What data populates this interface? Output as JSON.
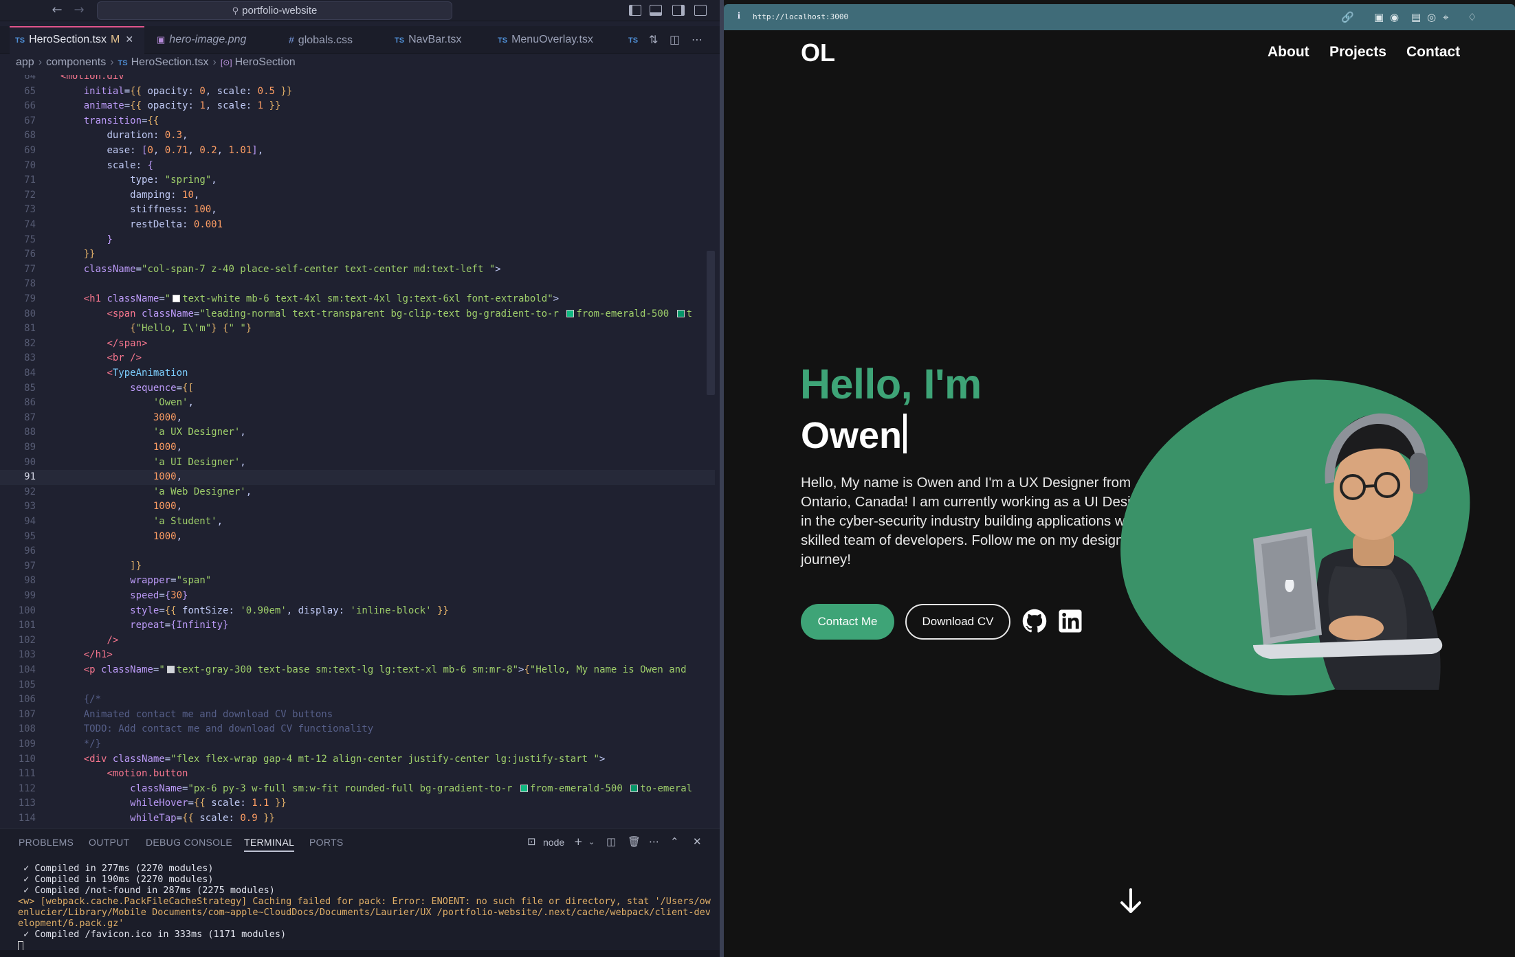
{
  "editor": {
    "search": "portfolio-website",
    "tabs": [
      {
        "label": "HeroSection.tsx",
        "kind": "ts",
        "modified": "M",
        "active": true
      },
      {
        "label": "hero-image.png",
        "kind": "img",
        "italic": true
      },
      {
        "label": "globals.css",
        "kind": "css"
      },
      {
        "label": "NavBar.tsx",
        "kind": "ts"
      },
      {
        "label": "MenuOverlay.tsx",
        "kind": "ts"
      }
    ],
    "ts_badge": "TS",
    "breadcrumb": [
      "app",
      "components",
      "HeroSection.tsx",
      "HeroSection"
    ],
    "current_line": 91,
    "code_lines": [
      {
        "n": 64,
        "h": "        <span class='tag'>&lt;motion.div</span>"
      },
      {
        "n": 65,
        "h": "            <span class='a'>initial</span><span class='p'>=</span><span class='b'>{{</span> <span class='p'>opacity:</span> <span class='n'>0</span><span class='p'>,</span> <span class='p'>scale:</span> <span class='n'>0.5</span> <span class='b'>}}</span>"
      },
      {
        "n": 66,
        "h": "            <span class='a'>animate</span><span class='p'>=</span><span class='b'>{{</span> <span class='p'>opacity:</span> <span class='n'>1</span><span class='p'>,</span> <span class='p'>scale:</span> <span class='n'>1</span> <span class='b'>}}</span>"
      },
      {
        "n": 67,
        "h": "            <span class='a'>transition</span><span class='p'>=</span><span class='b'>{{</span>"
      },
      {
        "n": 68,
        "h": "                <span class='p'>duration:</span> <span class='n'>0.3</span><span class='p'>,</span>"
      },
      {
        "n": 69,
        "h": "                <span class='p'>ease:</span> <span class='a'>[</span><span class='n'>0</span><span class='p'>,</span> <span class='n'>0.71</span><span class='p'>,</span> <span class='n'>0.2</span><span class='p'>,</span> <span class='n'>1.01</span><span class='a'>]</span><span class='p'>,</span>"
      },
      {
        "n": 70,
        "h": "                <span class='p'>scale:</span> <span class='a'>{</span>"
      },
      {
        "n": 71,
        "h": "                    <span class='p'>type:</span> <span class='s'>\"spring\"</span><span class='p'>,</span>"
      },
      {
        "n": 72,
        "h": "                    <span class='p'>damping:</span> <span class='n'>10</span><span class='p'>,</span>"
      },
      {
        "n": 73,
        "h": "                    <span class='p'>stiffness:</span> <span class='n'>100</span><span class='p'>,</span>"
      },
      {
        "n": 74,
        "h": "                    <span class='p'>restDelta:</span> <span class='n'>0.001</span>"
      },
      {
        "n": 75,
        "h": "                <span class='a'>}</span>"
      },
      {
        "n": 76,
        "h": "            <span class='b'>}}</span>"
      },
      {
        "n": 77,
        "h": "            <span class='a'>className</span><span class='p'>=</span><span class='s'>\"col-span-7 z-40 place-self-center text-center md:text-left \"</span><span class='p'>&gt;</span>"
      },
      {
        "n": 78,
        "h": ""
      },
      {
        "n": 79,
        "h": "            <span class='tag'>&lt;h1</span> <span class='a'>className</span><span class='p'>=</span><span class='s'>\"<span class='sw' style='background:#fff'></span>text-white mb-6 text-4xl sm:text-4xl lg:text-6xl font-extrabold\"</span><span class='p'>&gt;</span>"
      },
      {
        "n": 80,
        "h": "                <span class='tag'>&lt;span</span> <span class='a'>className</span><span class='p'>=</span><span class='s'>\"leading-normal text-transparent bg-clip-text bg-gradient-to-r <span class='sw' style='background:#10b981'></span>from-emerald-500 <span class='sw' style='background:#059669'></span>t</span>"
      },
      {
        "n": 81,
        "h": "                    <span class='b'>{</span><span class='s'>\"Hello, I\\'m\"</span><span class='b'>}</span> <span class='b'>{</span><span class='s'>\" \"</span><span class='b'>}</span>"
      },
      {
        "n": 82,
        "h": "                <span class='tag'>&lt;/span&gt;</span>"
      },
      {
        "n": 83,
        "h": "                <span class='tag'>&lt;br</span> <span class='tag'>/&gt;</span>"
      },
      {
        "n": 84,
        "h": "                <span class='tag'>&lt;</span><span class='t'>TypeAnimation</span>"
      },
      {
        "n": 85,
        "h": "                    <span class='a'>sequence</span><span class='p'>=</span><span class='b'>{[</span>"
      },
      {
        "n": 86,
        "h": "                        <span class='s'>'Owen'</span><span class='p'>,</span>"
      },
      {
        "n": 87,
        "h": "                        <span class='n'>3000</span><span class='p'>,</span>"
      },
      {
        "n": 88,
        "h": "                        <span class='s'>'a UX Designer'</span><span class='p'>,</span>"
      },
      {
        "n": 89,
        "h": "                        <span class='n'>1000</span><span class='p'>,</span>"
      },
      {
        "n": 90,
        "h": "                        <span class='s'>'a UI Designer'</span><span class='p'>,</span>"
      },
      {
        "n": 91,
        "h": "                        <span class='n'>1000</span><span class='p'>,</span>"
      },
      {
        "n": 92,
        "h": "                        <span class='s'>'a Web Designer'</span><span class='p'>,</span>"
      },
      {
        "n": 93,
        "h": "                        <span class='n'>1000</span><span class='p'>,</span>"
      },
      {
        "n": 94,
        "h": "                        <span class='s'>'a Student'</span><span class='p'>,</span>"
      },
      {
        "n": 95,
        "h": "                        <span class='n'>1000</span><span class='p'>,</span>"
      },
      {
        "n": 96,
        "h": ""
      },
      {
        "n": 97,
        "h": "                    <span class='b'>]}</span>"
      },
      {
        "n": 98,
        "h": "                    <span class='a'>wrapper</span><span class='p'>=</span><span class='s'>\"span\"</span>"
      },
      {
        "n": 99,
        "h": "                    <span class='a'>speed</span><span class='p'>=</span><span class='a'>{</span><span class='n'>30</span><span class='a'>}</span>"
      },
      {
        "n": 100,
        "h": "                    <span class='a'>style</span><span class='p'>=</span><span class='b'>{{</span> <span class='p'>fontSize:</span> <span class='s'>'0.90em'</span><span class='p'>,</span> <span class='p'>display:</span> <span class='s'>'inline-block'</span> <span class='b'>}}</span>"
      },
      {
        "n": 101,
        "h": "                    <span class='a'>repeat</span><span class='p'>=</span><span class='a'>{Infinity}</span>"
      },
      {
        "n": 102,
        "h": "                <span class='tag'>/&gt;</span>"
      },
      {
        "n": 103,
        "h": "            <span class='tag'>&lt;/h1&gt;</span>"
      },
      {
        "n": 104,
        "h": "            <span class='tag'>&lt;p</span> <span class='a'>className</span><span class='p'>=</span><span class='s'>\"<span class='sw' style='background:#d1d5db'></span>text-gray-300 text-base sm:text-lg lg:text-xl mb-6 sm:mr-8\"</span><span class='p'>&gt;</span><span class='b'>{</span><span class='s'>\"Hello, My name is Owen and</span>"
      },
      {
        "n": 105,
        "h": ""
      },
      {
        "n": 106,
        "h": "            <span class='c'>{/*</span>"
      },
      {
        "n": 107,
        "h": "            <span class='c'>Animated contact me and download CV buttons</span>"
      },
      {
        "n": 108,
        "h": "            <span class='c'>TODO: Add contact me and download CV functionality</span>"
      },
      {
        "n": 109,
        "h": "            <span class='c'>*/}</span>"
      },
      {
        "n": 110,
        "h": "            <span class='tag'>&lt;div</span> <span class='a'>className</span><span class='p'>=</span><span class='s'>\"flex flex-wrap gap-4 mt-12 align-center justify-center lg:justify-start \"</span><span class='p'>&gt;</span>"
      },
      {
        "n": 111,
        "h": "                <span class='tag'>&lt;motion.button</span>"
      },
      {
        "n": 112,
        "h": "                    <span class='a'>className</span><span class='p'>=</span><span class='s'>\"px-6 py-3 w-full sm:w-fit rounded-full bg-gradient-to-r <span class='sw' style='background:#10b981'></span>from-emerald-500 <span class='sw' style='background:#059669'></span>to-emeral</span>"
      },
      {
        "n": 113,
        "h": "                    <span class='a'>whileHover</span><span class='p'>=</span><span class='b'>{{</span> <span class='p'>scale:</span> <span class='n'>1.1</span> <span class='b'>}}</span>"
      },
      {
        "n": 114,
        "h": "                    <span class='a'>whileTap</span><span class='p'>=</span><span class='b'>{{</span> <span class='p'>scale:</span> <span class='n'>0.9</span> <span class='b'>}}</span>"
      }
    ],
    "panel": {
      "tabs": [
        "PROBLEMS",
        "OUTPUT",
        "DEBUG CONSOLE",
        "TERMINAL",
        "PORTS"
      ],
      "active_tab": "TERMINAL",
      "shell": "node",
      "terminal": [
        {
          "kind": "ok",
          "text": " ✓ Compiled in 277ms (2270 modules)"
        },
        {
          "kind": "ok",
          "text": " ✓ Compiled in 190ms (2270 modules)"
        },
        {
          "kind": "ok",
          "text": " ✓ Compiled /not-found in 287ms (2275 modules)"
        },
        {
          "kind": "warn",
          "text": "<w> [webpack.cache.PackFileCacheStrategy] Caching failed for pack: Error: ENOENT: no such file or directory, stat '/Users/owenlucier/Library/Mobile Documents/com~apple~CloudDocs/Documents/Laurier/UX /portfolio-website/.next/cache/webpack/client-development/6.pack.gz'"
        },
        {
          "kind": "ok",
          "text": " ✓ Compiled /favicon.ico in 333ms (1171 modules)"
        }
      ]
    }
  },
  "browser": {
    "url": "http://localhost:3000",
    "site": {
      "logo": "OL",
      "nav": [
        "About",
        "Projects",
        "Contact"
      ],
      "greeting": "Hello, I'm",
      "typed_word": "Owen",
      "bio": "Hello, My name is Owen and I'm a UX Designer from Ontario, Canada! I am currently working as a UI Designer in the cyber-security industry building applications with a skilled team of developers. Follow me on my design journey!",
      "contact_button": "Contact Me",
      "cv_button": "Download CV",
      "social_icons": [
        "github-icon",
        "linkedin-icon"
      ],
      "accent_color": "#3ea477",
      "background_color": "#121212"
    }
  }
}
